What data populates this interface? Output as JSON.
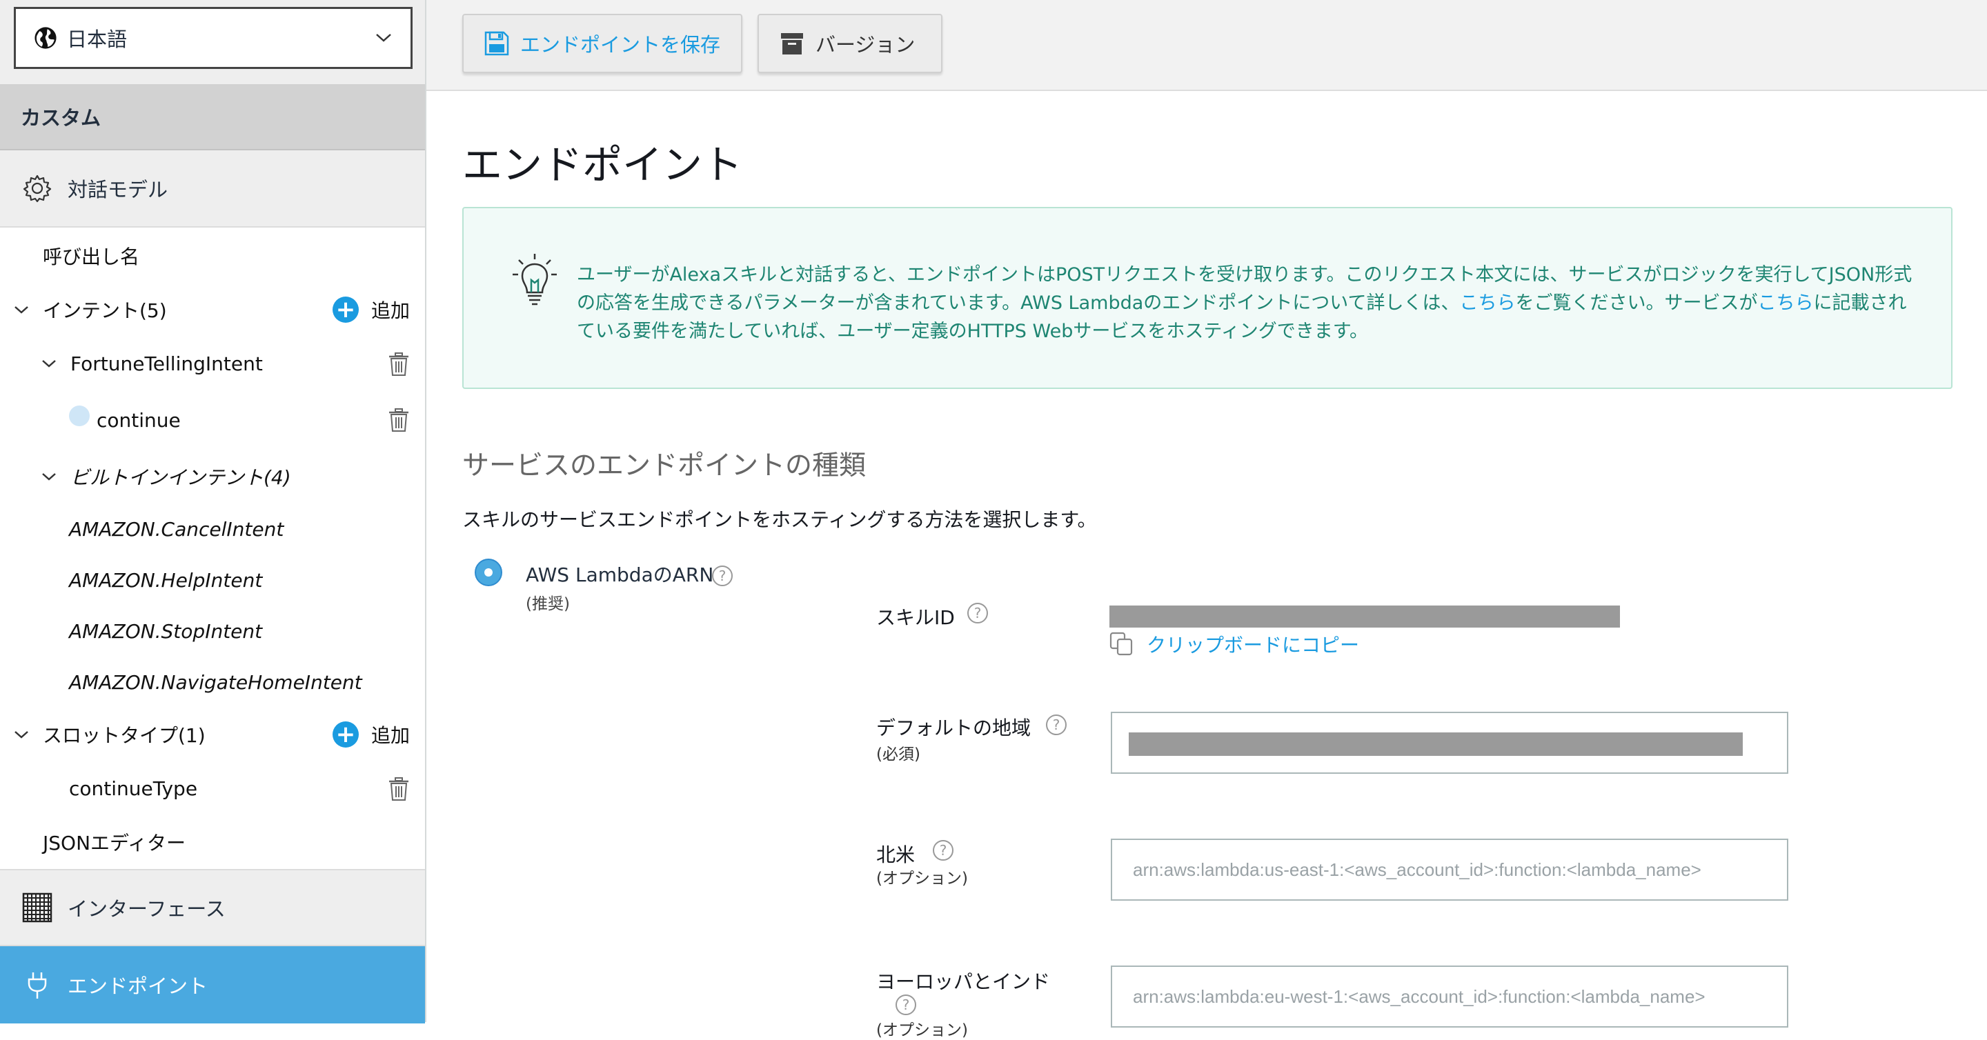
{
  "sidebar": {
    "language": "日本語",
    "custom_label": "カスタム",
    "interaction_model_label": "対話モデル",
    "invocation_label": "呼び出し名",
    "intents_label": "インテント(5)",
    "add_label": "追加",
    "custom_intents": [
      "FortuneTellingIntent"
    ],
    "slot_label": "continue",
    "builtin_intents_label": "ビルトインインテント(4)",
    "builtin_intents": [
      "AMAZON.CancelIntent",
      "AMAZON.HelpIntent",
      "AMAZON.StopIntent",
      "AMAZON.NavigateHomeIntent"
    ],
    "slot_types_label": "スロットタイプ(1)",
    "slot_types": [
      "continueType"
    ],
    "json_editor_label": "JSONエディター",
    "interfaces_label": "インターフェース",
    "endpoint_label": "エンドポイント"
  },
  "toolbar": {
    "save_label": "エンドポイントを保存",
    "version_label": "バージョン"
  },
  "main": {
    "title": "エンドポイント",
    "info": {
      "part1": "ユーザーがAlexaスキルと対話すると、エンドポイントはPOSTリクエストを受け取ります。このリクエスト本文には、サービスがロジックを実行してJSON形式の応答を生成できるパラメーターが含まれています。AWS Lambdaのエンドポイントについて詳しくは、",
      "link1": "こちら",
      "part2": "をご覧ください。サービスが",
      "link2": "こちら",
      "part3": "に記載されている要件を満たしていれば、ユーザー定義のHTTPS Webサービスをホスティングできます。"
    },
    "section_title": "サービスのエンドポイントの種類",
    "section_desc": "スキルのサービスエンドポイントをホスティングする方法を選択します。",
    "radio_label": "AWS LambdaのARN",
    "radio_sub": "(推奨)",
    "help_glyph": "?",
    "skill_id_label": "スキルID",
    "copy_label": "クリップボードにコピー",
    "default_region_label": "デフォルトの地域",
    "required_label": "(必須)",
    "na_label": "北米",
    "optional_label": "(オプション)",
    "na_placeholder": "arn:aws:lambda:us-east-1:<aws_account_id>:function:<lambda_name>",
    "eu_label": "ヨーロッパとインド",
    "eu_placeholder": "arn:aws:lambda:eu-west-1:<aws_account_id>:function:<lambda_name>"
  },
  "colors": {
    "accent": "#1a9be0",
    "active_nav": "#4aa9e0",
    "info_text": "#1e8572",
    "info_bg": "#f1faf8",
    "info_border": "#b9e4d4"
  },
  "icons": {
    "language": "globe-icon",
    "language_dropdown": "chevron-down-icon",
    "interaction_model": "gear-icon",
    "add": "plus-circle-icon",
    "delete": "trash-icon",
    "interfaces": "grid-icon",
    "endpoint": "plug-icon",
    "save": "floppy-disk-icon",
    "version": "archive-box-icon",
    "tip": "lightbulb-icon",
    "copy": "copy-icon"
  }
}
